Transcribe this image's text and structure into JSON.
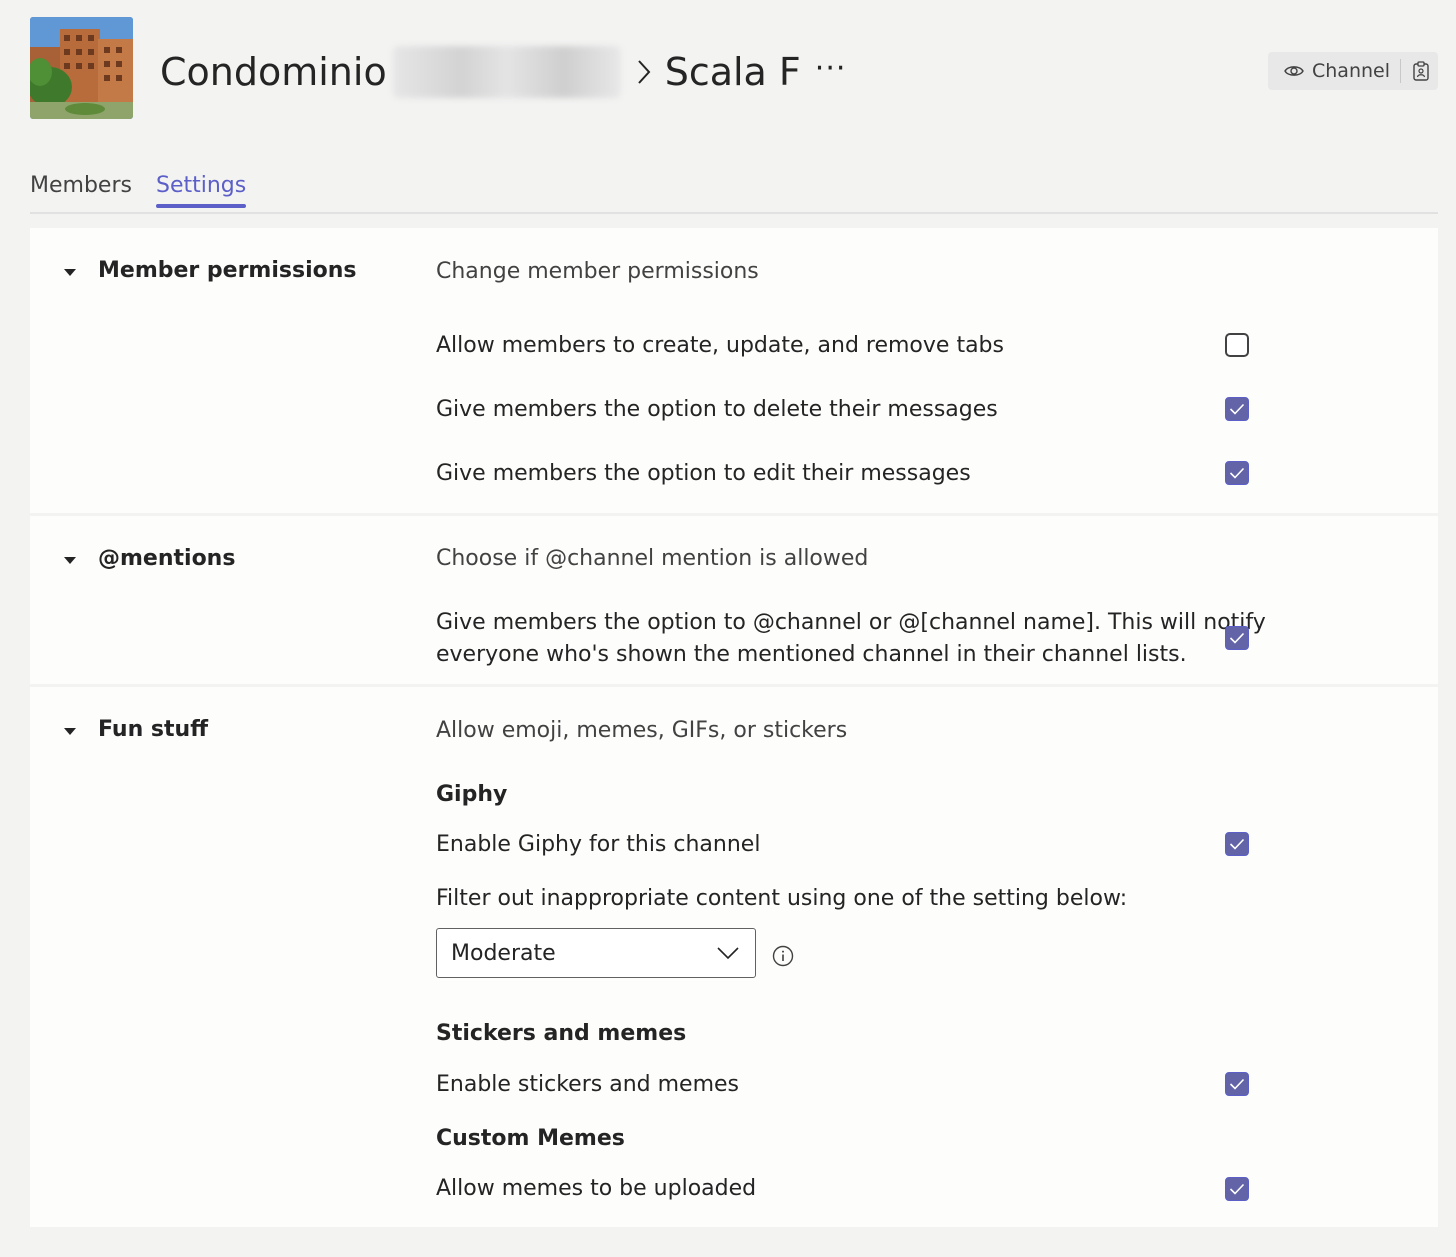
{
  "header": {
    "team_name": "Condominio",
    "channel_name": "Scala F",
    "more_glyph": "···",
    "channel_button_label": "Channel"
  },
  "tabs": [
    {
      "label": "Members",
      "active": false
    },
    {
      "label": "Settings",
      "active": true
    }
  ],
  "member_permissions": {
    "title": "Member permissions",
    "description": "Change member permissions",
    "options": [
      {
        "label": "Allow members to create, update, and remove tabs",
        "checked": false
      },
      {
        "label": "Give members the option to delete their messages",
        "checked": true
      },
      {
        "label": "Give members the option to edit their messages",
        "checked": true
      }
    ]
  },
  "mentions": {
    "title": "@mentions",
    "description": "Choose if @channel mention is allowed",
    "option_line1": "Give members the option to @channel or @[channel name]. This will notify",
    "option_line2": "everyone who's shown the mentioned channel in their channel lists.",
    "checked": true
  },
  "fun_stuff": {
    "title": "Fun stuff",
    "description": "Allow emoji, memes, GIFs, or stickers",
    "giphy_title": "Giphy",
    "giphy_enable": "Enable Giphy for this channel",
    "giphy_checked": true,
    "filter_text": "Filter out inappropriate content using one of the setting below:",
    "filter_value": "Moderate",
    "stickers_title": "Stickers and memes",
    "stickers_enable": "Enable stickers and memes",
    "stickers_checked": true,
    "custom_title": "Custom Memes",
    "custom_enable": "Allow memes to be uploaded",
    "custom_checked": true
  },
  "colors": {
    "accent": "#5b5fc7",
    "checkbox_fill": "#6264a7",
    "page_bg": "#f3f3f2",
    "panel_bg": "#fdfdfc"
  },
  "icons": [
    "eye-icon",
    "clipboard-icon",
    "chevron-right-icon",
    "caret-down-icon",
    "checkmark-icon",
    "chevron-down-icon",
    "info-icon"
  ]
}
